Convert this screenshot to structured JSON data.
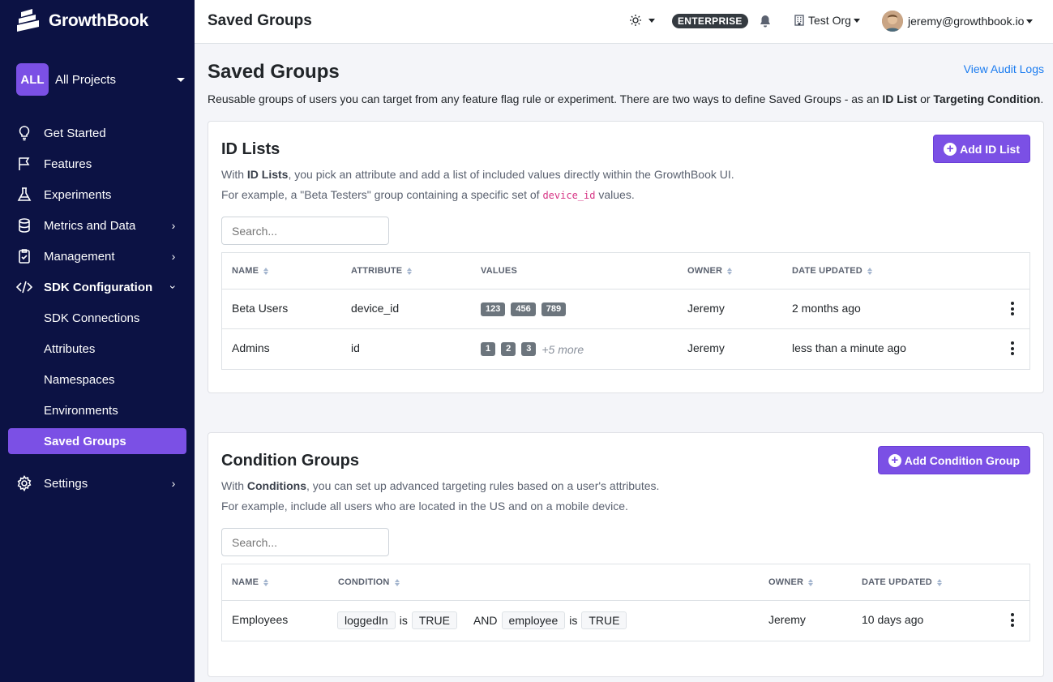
{
  "app": {
    "name": "GrowthBook"
  },
  "project": {
    "badge": "ALL",
    "label": "All Projects"
  },
  "nav": {
    "get_started": "Get Started",
    "features": "Features",
    "experiments": "Experiments",
    "metrics": "Metrics and Data",
    "management": "Management",
    "sdk_config": "SDK Configuration",
    "sdk_connections": "SDK Connections",
    "attributes": "Attributes",
    "namespaces": "Namespaces",
    "environments": "Environments",
    "saved_groups": "Saved Groups",
    "settings": "Settings"
  },
  "topbar": {
    "title": "Saved Groups",
    "plan_badge": "ENTERPRISE",
    "org": "Test Org",
    "user_email": "jeremy@growthbook.io"
  },
  "page": {
    "heading": "Saved Groups",
    "audit_link": "View Audit Logs",
    "desc_pre": "Reusable groups of users you can target from any feature flag rule or experiment. There are two ways to define Saved Groups - as an ",
    "desc_b1": "ID List",
    "desc_mid": " or ",
    "desc_b2": "Targeting Condition",
    "desc_end": "."
  },
  "id_lists": {
    "title": "ID Lists",
    "add_button": "Add ID List",
    "line1_pre": "With ",
    "line1_b": "ID Lists",
    "line1_post": ", you pick an attribute and add a list of included values directly within the GrowthBook UI.",
    "line2_pre": "For example, a \"Beta Testers\" group containing a specific set of ",
    "line2_code": "device_id",
    "line2_post": " values.",
    "search_placeholder": "Search...",
    "columns": {
      "name": "NAME",
      "attribute": "ATTRIBUTE",
      "values": "VALUES",
      "owner": "OWNER",
      "date": "DATE UPDATED"
    },
    "rows": [
      {
        "name": "Beta Users",
        "attribute": "device_id",
        "values": [
          "123",
          "456",
          "789"
        ],
        "more": "",
        "owner": "Jeremy",
        "date": "2 months ago"
      },
      {
        "name": "Admins",
        "attribute": "id",
        "values": [
          "1",
          "2",
          "3"
        ],
        "more": "+5 more",
        "owner": "Jeremy",
        "date": "less than a minute ago"
      }
    ]
  },
  "condition_groups": {
    "title": "Condition Groups",
    "add_button": "Add Condition Group",
    "line1_pre": "With ",
    "line1_b": "Conditions",
    "line1_post": ", you can set up advanced targeting rules based on a user's attributes.",
    "line2": "For example, include all users who are located in the US and on a mobile device.",
    "search_placeholder": "Search...",
    "columns": {
      "name": "NAME",
      "condition": "CONDITION",
      "owner": "OWNER",
      "date": "DATE UPDATED"
    },
    "rows": [
      {
        "name": "Employees",
        "attr1": "loggedIn",
        "op1": "is",
        "val1": "TRUE",
        "joiner": "AND",
        "attr2": "employee",
        "op2": "is",
        "val2": "TRUE",
        "owner": "Jeremy",
        "date": "10 days ago"
      }
    ]
  },
  "colors": {
    "sidebar_bg": "#0c1244",
    "accent": "#7b50e5",
    "link": "#1b7cf0"
  }
}
